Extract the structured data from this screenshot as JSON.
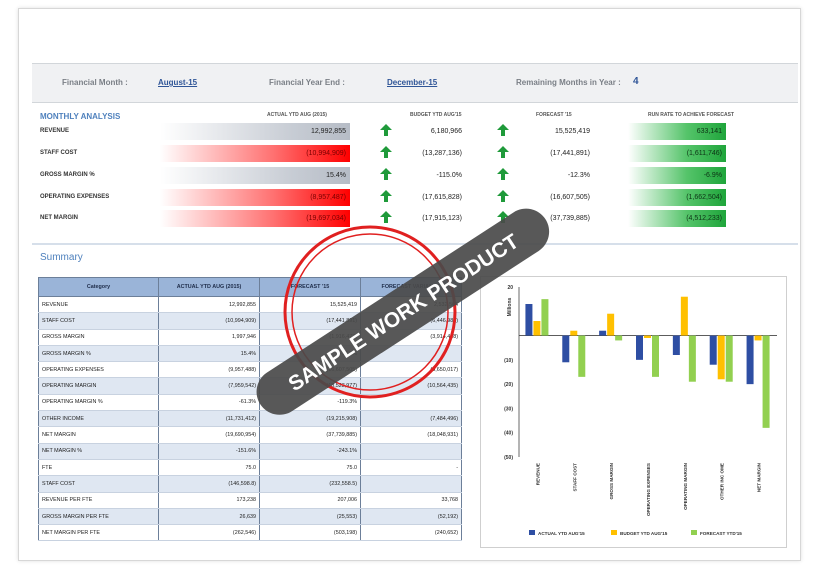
{
  "header": {
    "financial_month_label": "Financial Month :",
    "financial_month_value": "August-15",
    "fy_end_label": "Financial Year End :",
    "fy_end_value": "December-15",
    "remaining_label": "Remaining Months in Year :",
    "remaining_value": "4"
  },
  "monthly": {
    "title": "MONTHLY ANALYSIS",
    "col_actual": "ACTUAL YTD AUG (2015)",
    "col_budget": "BUDGET YTD AUG'15",
    "col_forecast": "FORECAST '15",
    "col_runrate": "RUN RATE TO ACHIEVE FORECAST",
    "rows": [
      {
        "label": "REVENUE",
        "actual": "12,992,855",
        "budget": "6,180,966",
        "forecast": "15,525,419",
        "runrate": "633,141"
      },
      {
        "label": "STAFF COST",
        "actual": "(10,994,909)",
        "budget": "(13,287,136)",
        "forecast": "(17,441,891)",
        "runrate": "(1,611,746)"
      },
      {
        "label": "GROSS MARGIN %",
        "actual": "15.4%",
        "budget": "-115.0%",
        "forecast": "-12.3%",
        "runrate": "-6.9%"
      },
      {
        "label": "OPERATING EXPENSES",
        "actual": "(8,957,487)",
        "budget": "(17,615,828)",
        "forecast": "(16,607,505)",
        "runrate": "(1,662,504)"
      },
      {
        "label": "NET MARGIN",
        "actual": "(19,697,034)",
        "budget": "(17,915,123)",
        "forecast": "(37,739,885)",
        "runrate": "(4,512,233)"
      }
    ],
    "colors": {
      "up_arrow": "#1f9a3a",
      "gray_bar": "#b6bcc6",
      "red_bar": "#ff0000",
      "green_bar": "#1fa53b"
    }
  },
  "summary": {
    "title": "Summary",
    "headers": [
      "Category",
      "ACTUAL YTD AUG (2015)",
      "FORECAST '15",
      "FORECAST VARIANCE"
    ],
    "rows": [
      [
        "REVENUE",
        "12,992,855",
        "15,525,419",
        "2,532,564"
      ],
      [
        "STAFF COST",
        "(10,994,909)",
        "(17,441,891)",
        "(6,446,982)"
      ],
      [
        "GROSS MARGIN",
        "1,997,946",
        "(1,916,472)",
        "(3,914,418)"
      ],
      [
        "GROSS MARGIN %",
        "15.4%",
        "-12.3%",
        ""
      ],
      [
        "OPERATING EXPENSES",
        "(9,957,488)",
        "(16,607,505)",
        "(6,650,017)"
      ],
      [
        "OPERATING MARGIN",
        "(7,959,542)",
        "(18,523,977)",
        "(10,564,435)"
      ],
      [
        "OPERATING MARGIN %",
        "-61.3%",
        "-119.3%",
        ""
      ],
      [
        "OTHER INCOME",
        "(11,731,412)",
        "(19,215,908)",
        "(7,484,496)"
      ],
      [
        "NET MARGIN",
        "(19,690,954)",
        "(37,739,885)",
        "(18,048,931)"
      ],
      [
        "NET MARGIN %",
        "-151.6%",
        "-243.1%",
        ""
      ],
      [
        "FTE",
        "75.0",
        "75.0",
        "-"
      ],
      [
        "STAFF COST",
        "(146,598.8)",
        "(232,558.5)",
        ""
      ],
      [
        "REVENUE PER FTE",
        "173,238",
        "207,006",
        "33,768"
      ],
      [
        "GROSS MARGIN PER FTE",
        "26,639",
        "(25,553)",
        "(52,192)"
      ],
      [
        "NET MARGIN PER FTE",
        "(262,546)",
        "(503,198)",
        "(240,652)"
      ]
    ]
  },
  "chart_data": {
    "type": "bar",
    "categories": [
      "REVENUE",
      "STAFF COST",
      "GROSS MARGIN",
      "OPERATING EXPENSES",
      "OPERATING MARGIN",
      "OTHER INC OME",
      "NET MARGIN"
    ],
    "ylabel": "Millions",
    "yticks": [
      "20",
      "",
      "(10)",
      "(20)",
      "(30)",
      "(40)",
      "(50)"
    ],
    "ylim": [
      -50,
      20
    ],
    "series": [
      {
        "name": "ACTUAL YTD AUG'15",
        "color": "#2e4ea3",
        "values": [
          13,
          -11,
          2,
          -10,
          -8,
          -12,
          -20
        ]
      },
      {
        "name": "BUDGET YTD AUG'15",
        "color": "#ffc000",
        "values": [
          6,
          2,
          9,
          -1,
          16,
          -18,
          -2
        ]
      },
      {
        "name": "FORECAST YTD'15",
        "color": "#92d050",
        "values": [
          15,
          -17,
          -2,
          -17,
          -19,
          -19,
          -38
        ]
      }
    ]
  },
  "watermark": {
    "text": "SAMPLE WORK PRODUCT"
  }
}
